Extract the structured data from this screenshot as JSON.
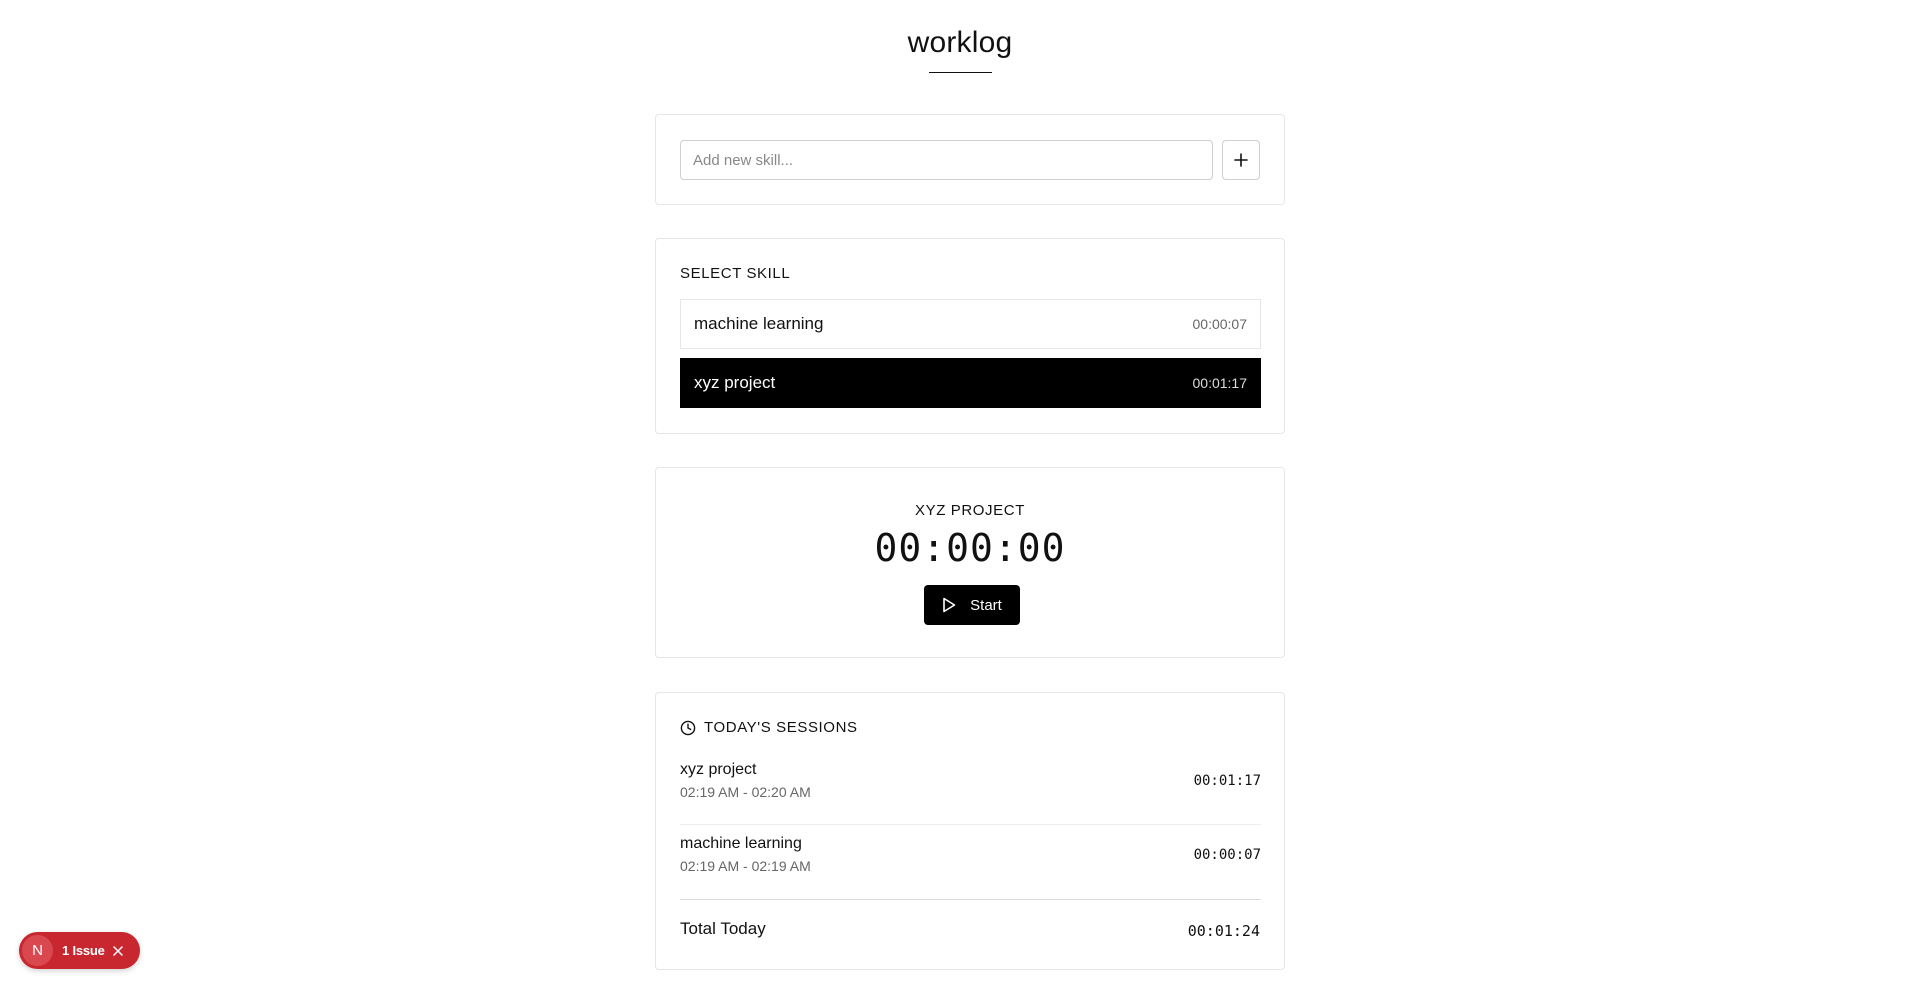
{
  "app": {
    "title": "worklog"
  },
  "add_skill": {
    "placeholder": "Add new skill...",
    "value": "",
    "add_icon": "plus-icon"
  },
  "select_skill": {
    "label": "SELECT SKILL",
    "items": [
      {
        "name": "machine learning",
        "total": "00:00:07",
        "selected": false
      },
      {
        "name": "xyz project",
        "total": "00:01:17",
        "selected": true
      }
    ]
  },
  "timer": {
    "skill": "XYZ PROJECT",
    "display": "00:00:00",
    "start_label": "Start",
    "start_icon": "play-icon"
  },
  "sessions": {
    "label": "TODAY'S SESSIONS",
    "icon": "clock-icon",
    "items": [
      {
        "name": "xyz project",
        "range": "02:19 AM - 02:20 AM",
        "duration": "00:01:17"
      },
      {
        "name": "machine learning",
        "range": "02:19 AM - 02:19 AM",
        "duration": "00:00:07"
      }
    ],
    "total_label": "Total Today",
    "total_value": "00:01:24"
  },
  "issue_badge": {
    "avatar_letter": "N",
    "text": "1 Issue",
    "color": "#c9272f"
  },
  "colors": {
    "accent": "#000000",
    "border": "#e6e6e6",
    "muted_text": "#666666"
  }
}
